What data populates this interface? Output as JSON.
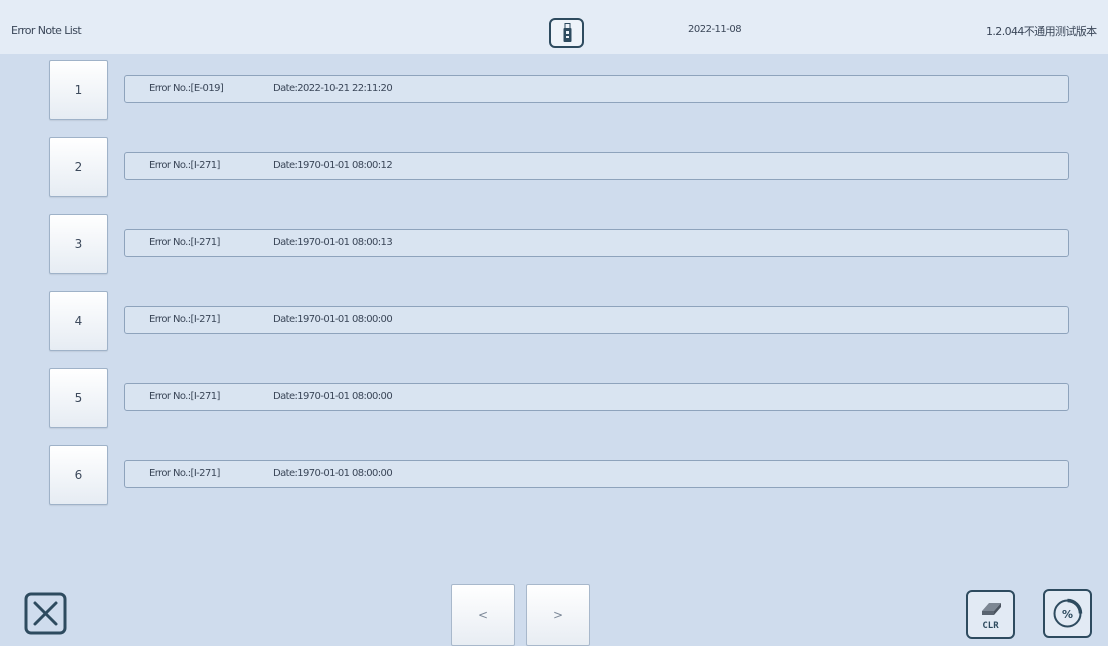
{
  "header": {
    "title": "Error Note List",
    "usb_icon": "usb-drive-icon",
    "date": "2022-11-08",
    "version": "1.2.044不通用测试版本"
  },
  "entries": [
    {
      "index": "1",
      "error_no": "Error No.:[E-019]",
      "date": "Date:2022-10-21 22:11:20"
    },
    {
      "index": "2",
      "error_no": "Error No.:[I-271]",
      "date": "Date:1970-01-01 08:00:12"
    },
    {
      "index": "3",
      "error_no": "Error No.:[I-271]",
      "date": "Date:1970-01-01 08:00:13"
    },
    {
      "index": "4",
      "error_no": "Error No.:[I-271]",
      "date": "Date:1970-01-01 08:00:00"
    },
    {
      "index": "5",
      "error_no": "Error No.:[I-271]",
      "date": "Date:1970-01-01 08:00:00"
    },
    {
      "index": "6",
      "error_no": "Error No.:[I-271]",
      "date": "Date:1970-01-01 08:00:00"
    }
  ],
  "footer": {
    "close_icon": "close-x-icon",
    "prev_label": "<",
    "next_label": ">",
    "clr_label": "CLR",
    "clr_icon": "eraser-icon",
    "percent_label": "%",
    "percent_icon": "percent-gauge-icon"
  },
  "colors": {
    "background": "#cfdced",
    "header": "#e4ecf6",
    "icon_stroke": "#2e4b5f",
    "box_border": "#8ea3bc"
  }
}
